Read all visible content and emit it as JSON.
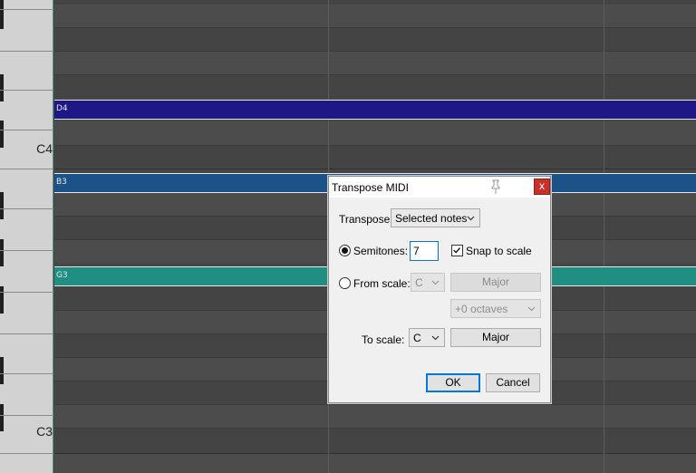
{
  "keyboard": {
    "labels": [
      "C4",
      "C3"
    ]
  },
  "notes": [
    {
      "label": "D4",
      "color": "#1e1787"
    },
    {
      "label": "B3",
      "color": "#1b5287"
    },
    {
      "label": "G3",
      "color": "#1f8f82"
    }
  ],
  "dialog": {
    "title": "Transpose MIDI",
    "close_label": "x",
    "transpose_label": "Transpose:",
    "transpose_value": "Selected notes",
    "semitones_label": "Semitones:",
    "semitones_value": "7",
    "snap_label": "Snap to scale",
    "from_scale_label": "From scale:",
    "from_key": "C",
    "from_mode": "Major",
    "octaves": "+0 octaves",
    "to_scale_label": "To scale:",
    "to_key": "C",
    "to_mode": "Major",
    "ok_label": "OK",
    "cancel_label": "Cancel"
  }
}
